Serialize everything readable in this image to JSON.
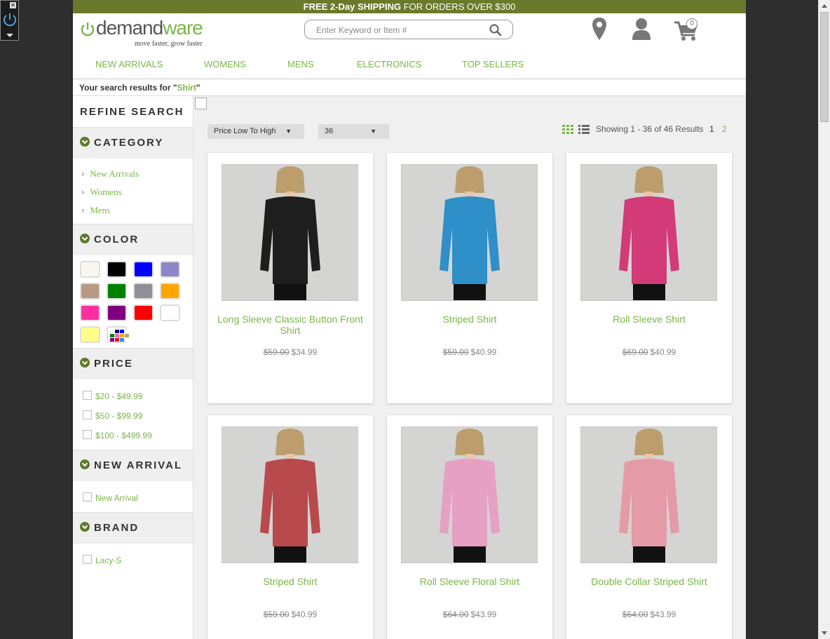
{
  "promo": {
    "bold": "FREE 2-Day SHIPPING",
    "rest": " FOR ORDERS OVER $300"
  },
  "logo": {
    "prefix": "demand",
    "suffix": "ware",
    "tagline": "move faster, grow faster"
  },
  "search": {
    "placeholder": "Enter Keyword or Item #"
  },
  "cart": {
    "count": "0"
  },
  "nav": [
    "NEW ARRIVALS",
    "WOMENS",
    "MENS",
    "ELECTRONICS",
    "TOP SELLERS"
  ],
  "results": {
    "prefix": "Your search results for \"",
    "query": "Shirt",
    "suffix": "\""
  },
  "sidebar": {
    "title": "REFINE SEARCH",
    "category": {
      "label": "CATEGORY",
      "items": [
        "New Arrivals",
        "Womens",
        "Mens"
      ]
    },
    "color": {
      "label": "COLOR",
      "swatches": [
        "#f7f7ee",
        "#000000",
        "#0000ff",
        "#8b86c9",
        "#b99983",
        "#008000",
        "#8e9096",
        "#ffa500",
        "#ff2fa0",
        "#800080",
        "#ff0000",
        "#ffffff",
        "#ffff88",
        "multi"
      ]
    },
    "price": {
      "label": "PRICE",
      "items": [
        "$20 - $49.99",
        "$50 - $99.99",
        "$100 - $499.99"
      ]
    },
    "new_arrival": {
      "label": "NEW ARRIVAL",
      "items": [
        "New Arrival"
      ]
    },
    "brand": {
      "label": "BRAND",
      "items": [
        "Lacy-S"
      ]
    }
  },
  "toolbar": {
    "sort": "Price Low To High",
    "per_page": "36",
    "showing": "Showing 1 - 36 of 46 Results",
    "pages": [
      "1",
      "2"
    ]
  },
  "products": [
    {
      "name": "Long Sleeve Classic Button Front Shirt",
      "old_price": "$59.00",
      "price": "$34.99",
      "shirt_color": "#1e1e1e"
    },
    {
      "name": "Striped Shirt",
      "old_price": "$59.00",
      "price": "$40.99",
      "shirt_color": "#2f8fc8"
    },
    {
      "name": "Roll Sleeve Shirt",
      "old_price": "$69.00",
      "price": "$40.99",
      "shirt_color": "#d23a78"
    },
    {
      "name": "Striped Shirt",
      "old_price": "$59.00",
      "price": "$40.99",
      "shirt_color": "#b84a4e"
    },
    {
      "name": "Roll Sleeve Floral Shirt",
      "old_price": "$64.00",
      "price": "$43.99",
      "shirt_color": "#e6a0c4"
    },
    {
      "name": "Double Collar Striped Shirt",
      "old_price": "$64.00",
      "price": "$43.99",
      "shirt_color": "#e59aa8"
    }
  ]
}
